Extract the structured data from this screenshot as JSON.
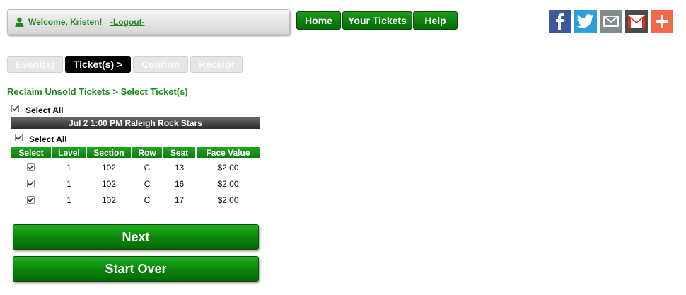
{
  "header": {
    "welcome_text": "Welcome, Kristen!",
    "logout_label": "-Logout-",
    "nav": [
      {
        "label": "Home"
      },
      {
        "label": "Your Tickets"
      },
      {
        "label": "Help"
      }
    ],
    "social": [
      {
        "icon": "facebook-icon",
        "color": "#3b5998"
      },
      {
        "icon": "twitter-icon",
        "color": "#2d9fd9"
      },
      {
        "icon": "email-icon",
        "color": "#7f8c8d"
      },
      {
        "icon": "gmail-icon",
        "color": "#4a4a4a"
      },
      {
        "icon": "share-plus-icon",
        "color": "#f16b4b"
      }
    ]
  },
  "steps": [
    {
      "label": "Event(s)",
      "active": false
    },
    {
      "label": "Ticket(s) >",
      "active": true
    },
    {
      "label": "Confirm",
      "active": false
    },
    {
      "label": "Receipt",
      "active": false
    }
  ],
  "page_title": "Reclaim Unsold Tickets > Select Ticket(s)",
  "select_all_label": "Select All",
  "event": {
    "label": "Jul 2 1:00 PM  Raleigh Rock Stars",
    "select_all_label": "Select All"
  },
  "table": {
    "headers": [
      "Select",
      "Level",
      "Section",
      "Row",
      "Seat",
      "Face Value"
    ],
    "rows": [
      {
        "checked": true,
        "level": "1",
        "section": "102",
        "row": "C",
        "seat": "13",
        "face_value": "$2.00"
      },
      {
        "checked": true,
        "level": "1",
        "section": "102",
        "row": "C",
        "seat": "16",
        "face_value": "$2.00"
      },
      {
        "checked": true,
        "level": "1",
        "section": "102",
        "row": "C",
        "seat": "17",
        "face_value": "$2.00"
      }
    ]
  },
  "buttons": {
    "next_label": "Next",
    "start_over_label": "Start Over"
  },
  "colors": {
    "brand_green": "#1e8a1e",
    "button_green": "#0a870a",
    "active_step": "#000000"
  }
}
